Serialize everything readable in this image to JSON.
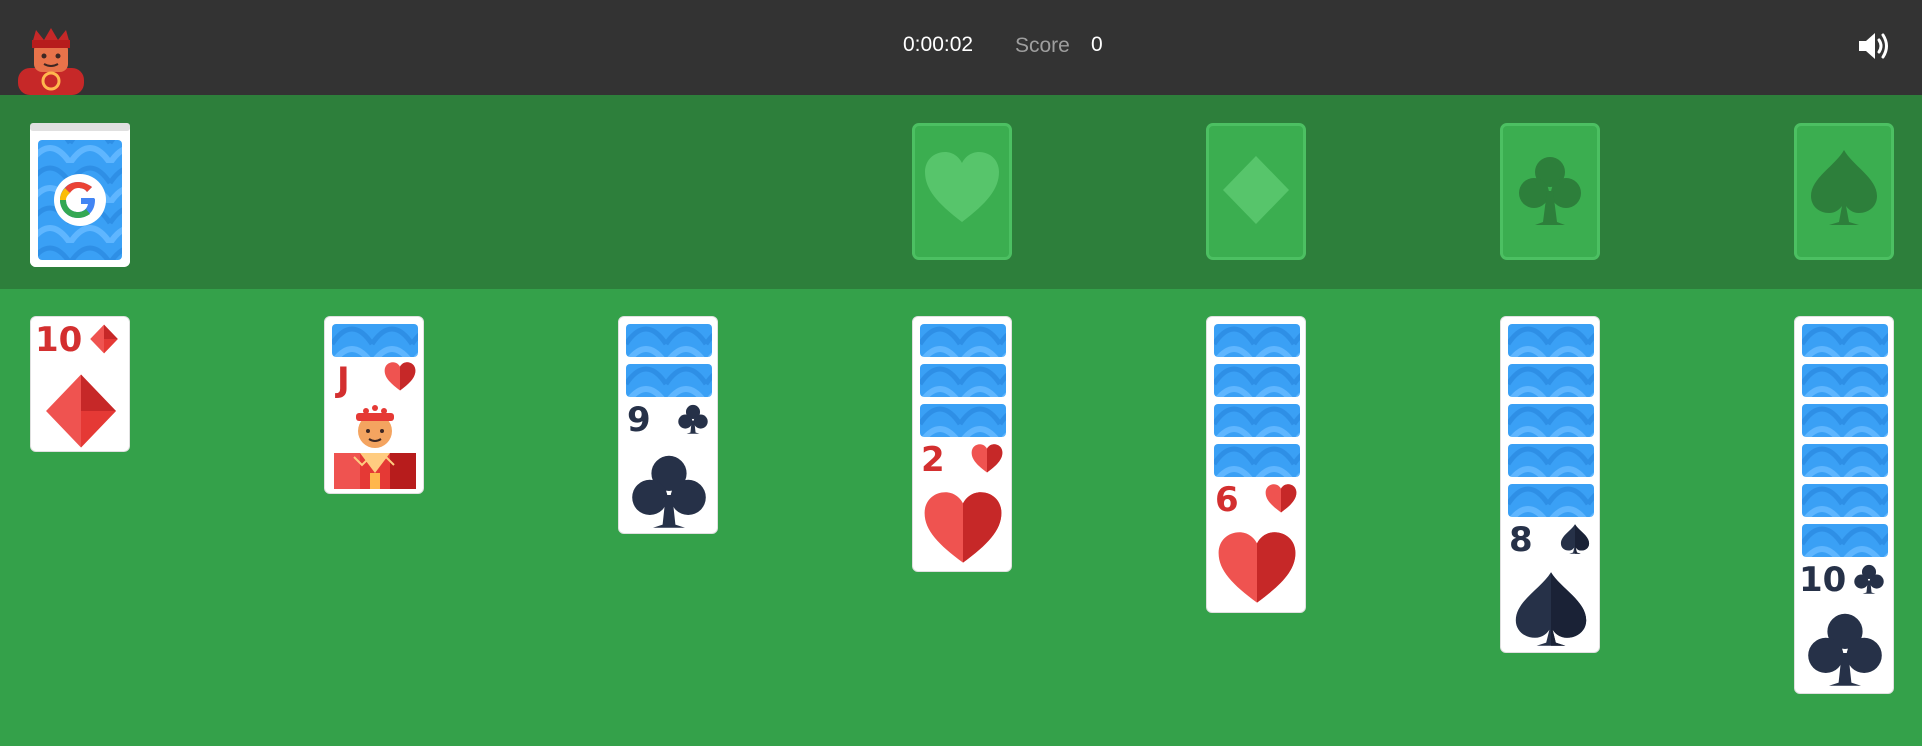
{
  "header": {
    "timer": "0:00:02",
    "score_label": "Score",
    "score_value": "0",
    "mascot": "jester-mascot",
    "sound_icon": "speaker-icon"
  },
  "colors": {
    "topbar": "#333333",
    "table_upper": "#2d7f3b",
    "table_lower": "#34a14a",
    "card_back": "#3aa0f5",
    "red_suit": "#d32f2f",
    "dark_suit": "#263148"
  },
  "stock": {
    "face_down": true,
    "logo": "google-g-logo"
  },
  "foundations": [
    {
      "suit": "hearts",
      "count": 0
    },
    {
      "suit": "diamonds",
      "count": 0
    },
    {
      "suit": "clubs",
      "count": 0
    },
    {
      "suit": "spades",
      "count": 0
    }
  ],
  "tableau": [
    {
      "hidden": 0,
      "top": {
        "rank": "10",
        "suit": "diamonds"
      }
    },
    {
      "hidden": 1,
      "top": {
        "rank": "J",
        "suit": "hearts"
      }
    },
    {
      "hidden": 2,
      "top": {
        "rank": "9",
        "suit": "clubs"
      }
    },
    {
      "hidden": 3,
      "top": {
        "rank": "2",
        "suit": "hearts"
      }
    },
    {
      "hidden": 4,
      "top": {
        "rank": "6",
        "suit": "hearts"
      }
    },
    {
      "hidden": 5,
      "top": {
        "rank": "8",
        "suit": "spades"
      }
    },
    {
      "hidden": 6,
      "top": {
        "rank": "10",
        "suit": "clubs"
      }
    }
  ]
}
